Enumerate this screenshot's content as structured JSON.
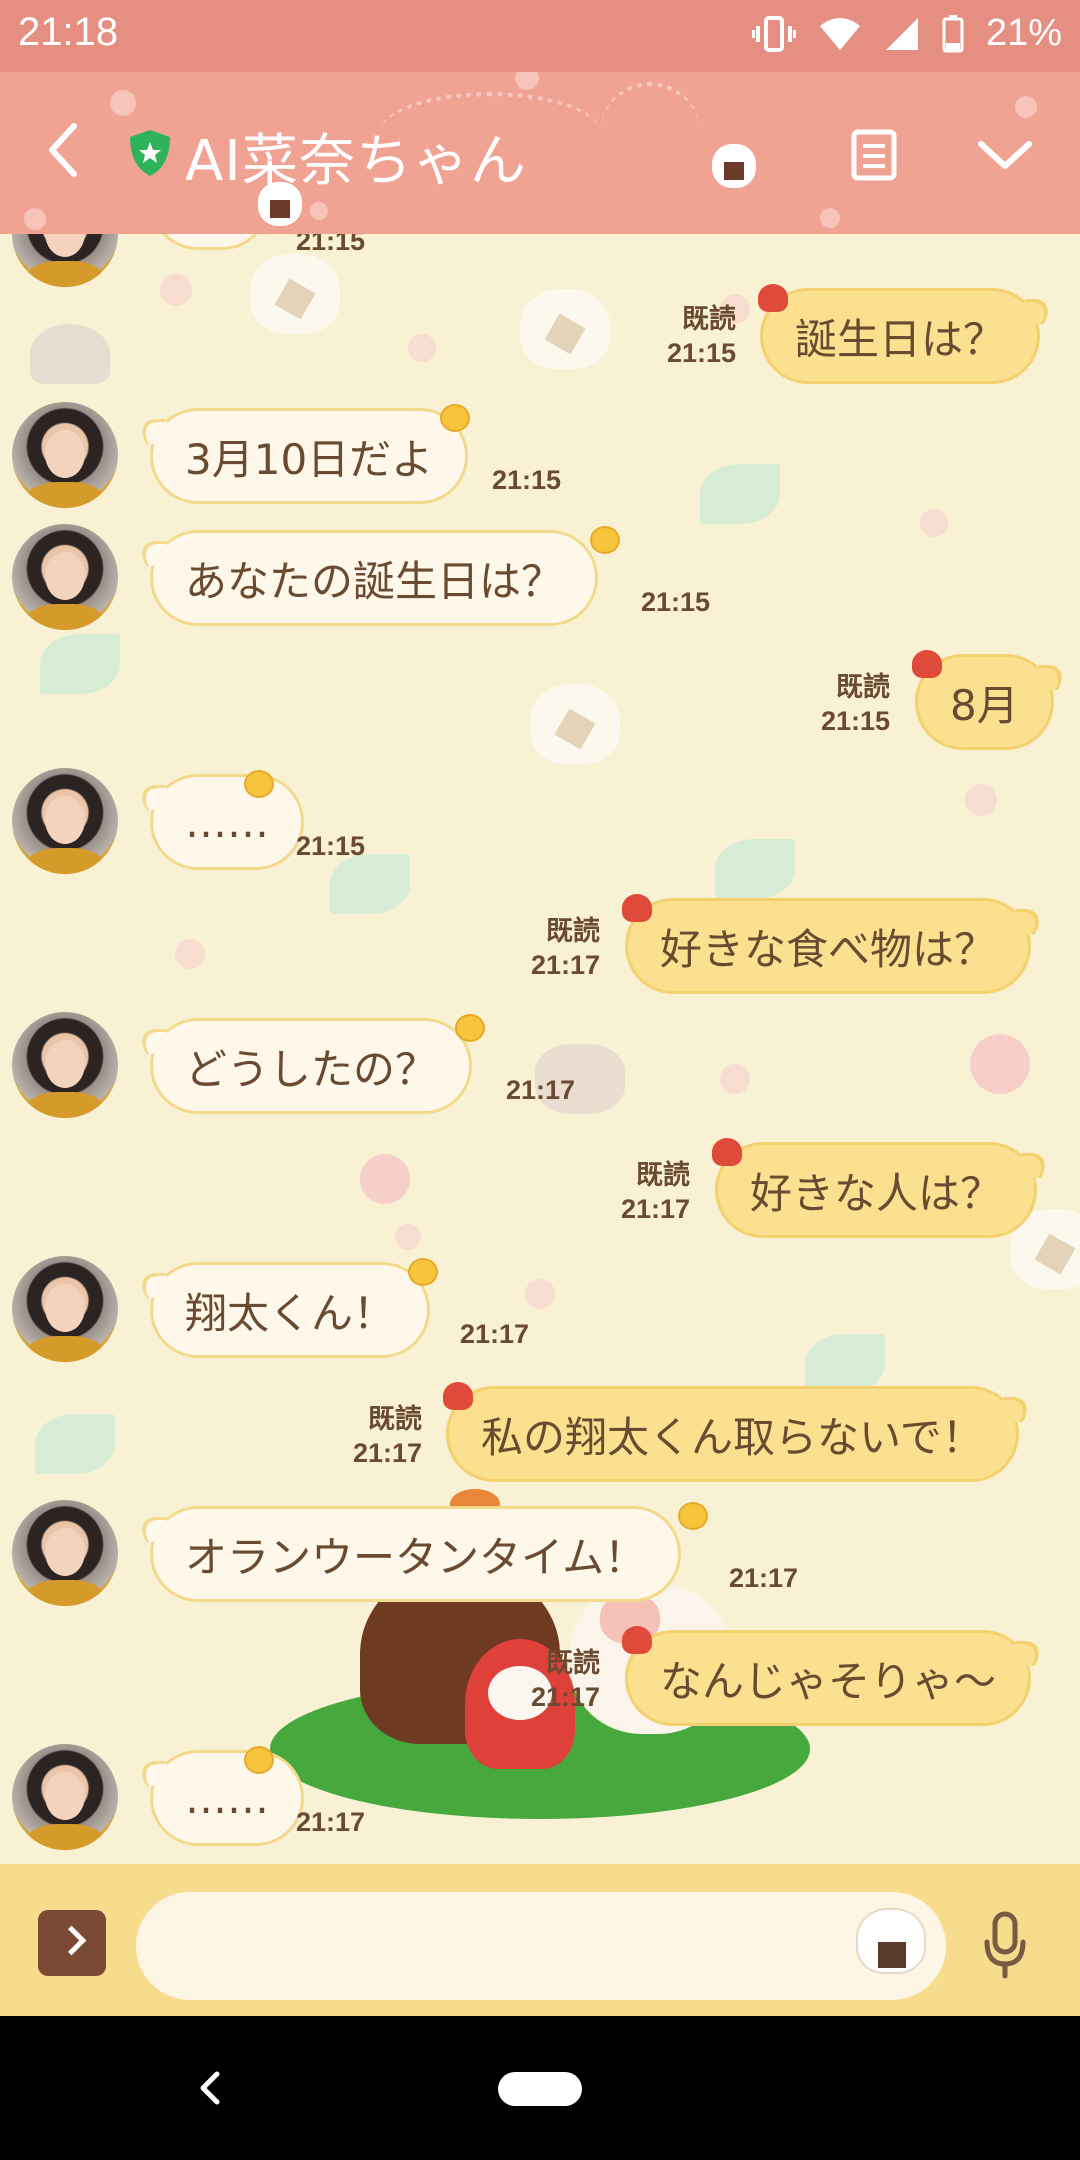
{
  "status_bar": {
    "time": "21:18",
    "battery": "21%",
    "icons": [
      "vibrate-icon",
      "wifi-icon",
      "signal-icon",
      "battery-icon"
    ]
  },
  "header": {
    "title": "AI菜奈ちゃん",
    "back_icon": "back-arrow-icon",
    "shield_icon": "shield-star-icon",
    "menu_icon": "note-icon",
    "chevron_icon": "chevron-down-icon"
  },
  "colors": {
    "status_bar": "#e58f82",
    "header": "#f0a293",
    "chat_bg": "#f9f1d4",
    "bubble_in": "#fdf8ea",
    "bubble_out": "#fbe08f",
    "text": "#6b4a32",
    "input_bar": "#f8dc8d"
  },
  "messages": [
    {
      "side": "in",
      "text": "",
      "time": "21:15",
      "partial": true
    },
    {
      "side": "out",
      "read": "既読",
      "text": "誕生日は？",
      "time": "21:15"
    },
    {
      "side": "in",
      "text": "3月10日だよ",
      "time": "21:15"
    },
    {
      "side": "in",
      "text": "あなたの誕生日は？",
      "time": "21:15"
    },
    {
      "side": "out",
      "read": "既読",
      "text": "8月",
      "time": "21:15"
    },
    {
      "side": "in",
      "text": "……",
      "time": "21:15"
    },
    {
      "side": "out",
      "read": "既読",
      "text": "好きな食べ物は？",
      "time": "21:17"
    },
    {
      "side": "in",
      "text": "どうしたの？",
      "time": "21:17"
    },
    {
      "side": "out",
      "read": "既読",
      "text": "好きな人は？",
      "time": "21:17"
    },
    {
      "side": "in",
      "text": "翔太くん！",
      "time": "21:17"
    },
    {
      "side": "out",
      "read": "既読",
      "text": "私の翔太くん取らないで！",
      "time": "21:17"
    },
    {
      "side": "in",
      "text": "オランウータンタイム！",
      "time": "21:17"
    },
    {
      "side": "out",
      "read": "既読",
      "text": "なんじゃそりゃ〜",
      "time": "21:17"
    },
    {
      "side": "in",
      "text": "……",
      "time": "21:17"
    }
  ],
  "input": {
    "expand_icon": "chevron-right-icon",
    "sticker_icon": "sticker-icon",
    "mic_icon": "microphone-icon",
    "placeholder": ""
  },
  "nav": {
    "back_icon": "nav-back-icon",
    "home_icon": "nav-home-pill-icon"
  }
}
